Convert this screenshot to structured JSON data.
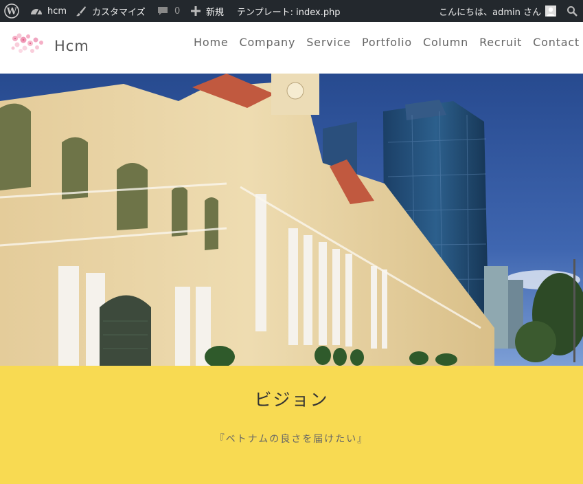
{
  "admin_bar": {
    "site_name": "hcm",
    "customize": "カスタマイズ",
    "comments_count": "0",
    "new": "新規",
    "template": "テンプレート: index.php",
    "greeting": "こんにちは、admin さん",
    "icons": [
      "wordpress-icon",
      "dashboard-icon",
      "brush-icon",
      "comment-icon",
      "plus-icon",
      "avatar",
      "search-icon"
    ]
  },
  "header": {
    "site_title": "Hcm",
    "nav": [
      "Home",
      "Company",
      "Service",
      "Portfolio",
      "Column",
      "Recruit",
      "Contact"
    ]
  },
  "vision": {
    "title": "ビジョン",
    "subtitle": "『ベトナムの良さを届けたい』"
  },
  "colors": {
    "admin_bar_bg": "#23282d",
    "vision_bg": "#f8da52",
    "nav_text": "#666666"
  }
}
